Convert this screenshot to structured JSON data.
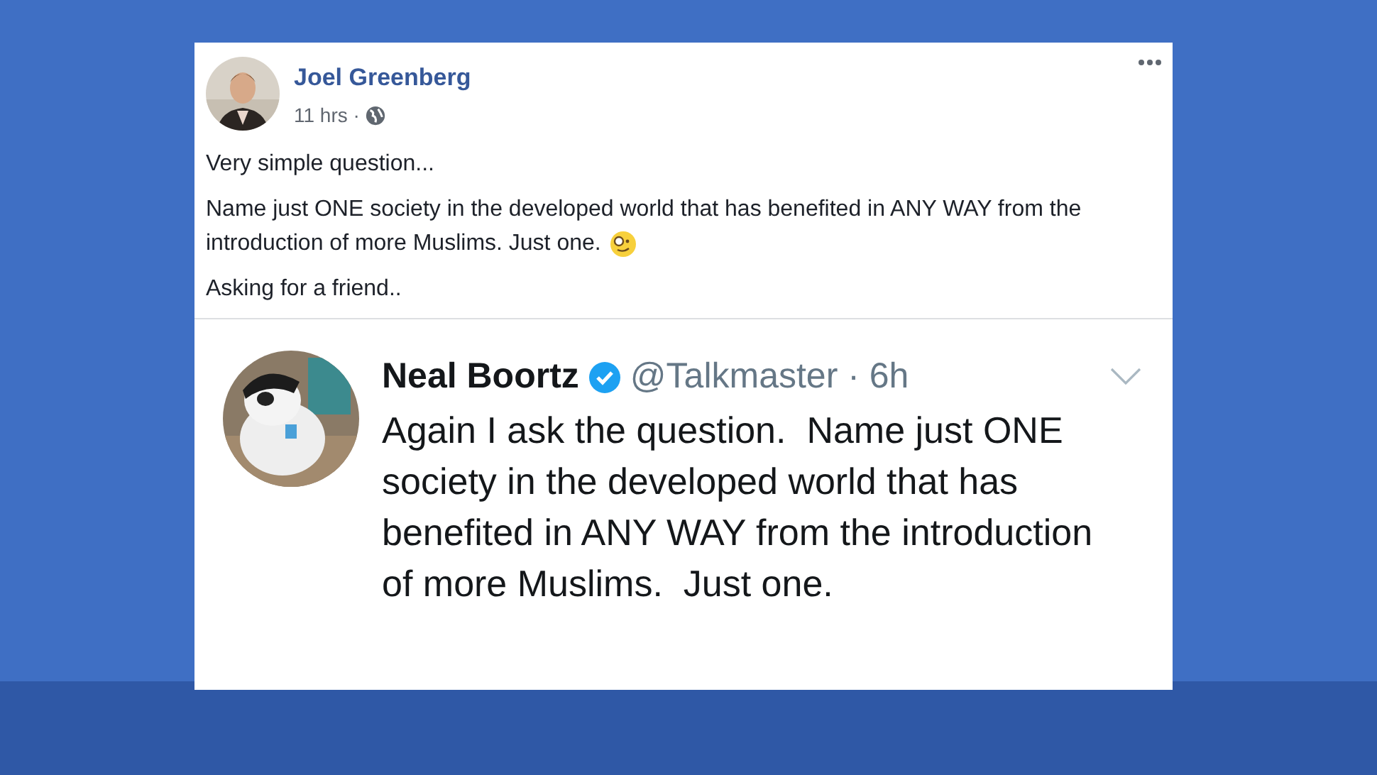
{
  "post": {
    "author": "Joel Greenberg",
    "time": "11 hrs ·",
    "paragraphs": [
      {
        "text": "Very simple question...",
        "emoji": false
      },
      {
        "text": "Name just ONE society in the developed world that has benefited in ANY WAY from the introduction of more Muslims. Just one.",
        "emoji": true
      },
      {
        "text": "Asking for a friend..",
        "emoji": false
      }
    ]
  },
  "tweet": {
    "name": "Neal Boortz",
    "verified": true,
    "handle": "@Talkmaster · 6h",
    "text": "Again I ask the question.  Name just ONE society in the developed world that has benefited in ANY WAY from the introduction of more Muslims.  Just one."
  }
}
